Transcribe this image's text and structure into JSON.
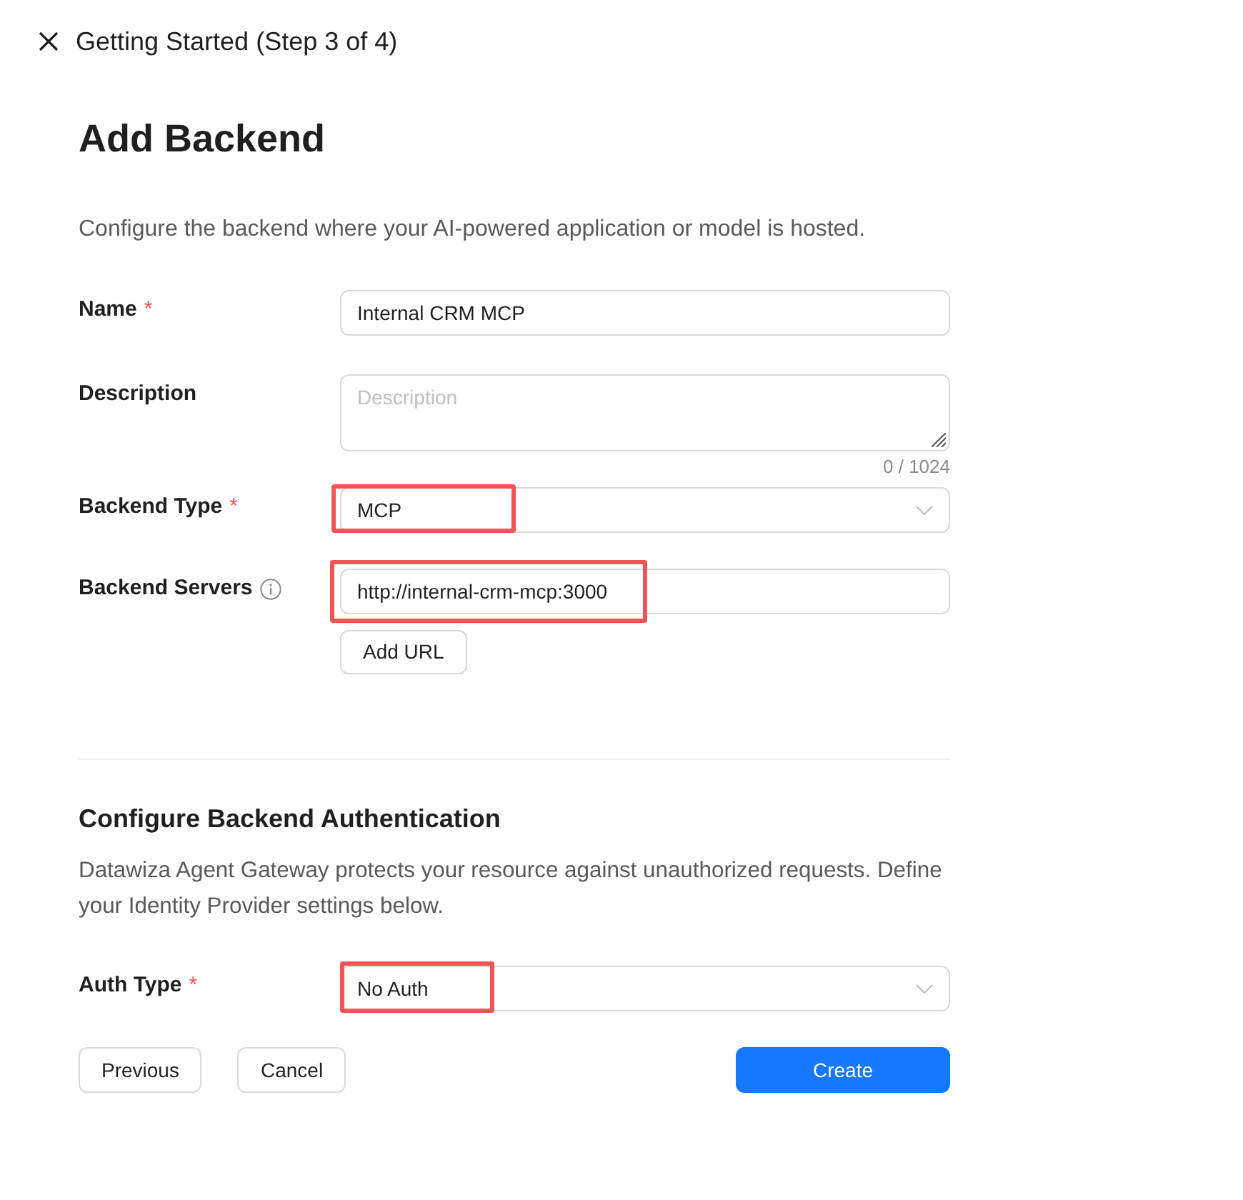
{
  "header": {
    "title": "Getting Started (Step 3 of 4)"
  },
  "page": {
    "title": "Add Backend",
    "description": "Configure the backend where your AI-powered application or model is hosted."
  },
  "fields": [
    {
      "kind": "input",
      "label": "Name",
      "required_mark": "*",
      "value": "Internal CRM MCP",
      "highlighted": false
    },
    {
      "kind": "textarea",
      "label": "Description",
      "placeholder": "Description",
      "counter": "0 / 1024",
      "highlighted": false
    },
    {
      "kind": "select",
      "label": "Backend Type",
      "required_mark": "*",
      "value": "MCP",
      "highlighted": true
    },
    {
      "kind": "url_list",
      "label": "Backend Servers",
      "info": true,
      "value": "http://internal-crm-mcp:3000",
      "add_button": "Add URL",
      "highlighted": true
    }
  ],
  "auth_section": {
    "title": "Configure Backend Authentication",
    "description": "Datawiza Agent Gateway protects your resource against unauthorized requests. Define your Identity Provider settings below.",
    "fields": [
      {
        "kind": "select",
        "label": "Auth Type",
        "required_mark": "*",
        "value": "No Auth",
        "highlighted": true
      }
    ]
  },
  "buttons": [
    {
      "label": "Previous",
      "kind": "default"
    },
    {
      "label": "Cancel",
      "kind": "default"
    },
    {
      "label": "Create",
      "kind": "primary"
    }
  ]
}
